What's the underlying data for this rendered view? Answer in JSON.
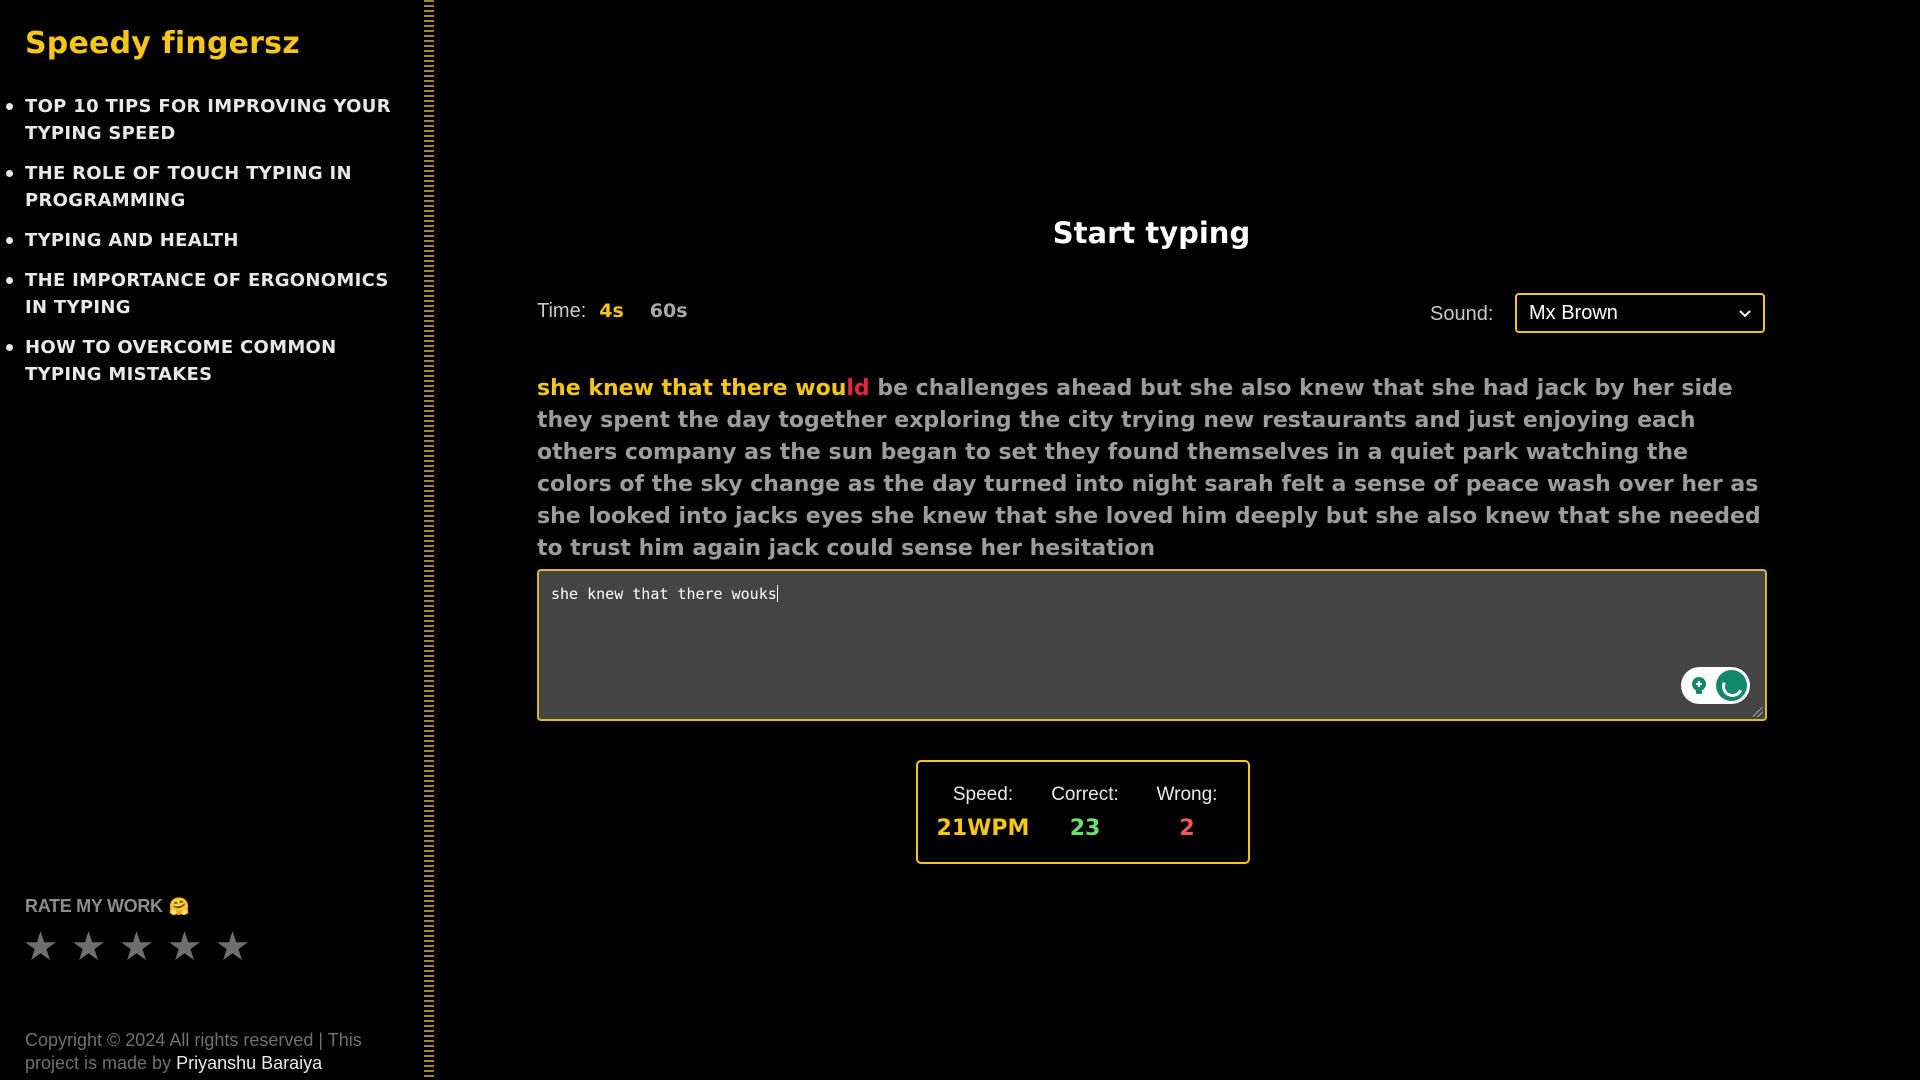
{
  "sidebar": {
    "brand": "Speedy fingersz",
    "items": [
      {
        "label": "TOP 10 TIPS FOR IMPROVING YOUR TYPING SPEED"
      },
      {
        "label": "THE ROLE OF TOUCH TYPING IN PROGRAMMING"
      },
      {
        "label": "TYPING AND HEALTH"
      },
      {
        "label": "THE IMPORTANCE OF ERGONOMICS IN TYPING"
      },
      {
        "label": "HOW TO OVERCOME COMMON TYPING MISTAKES"
      }
    ],
    "rate": {
      "title": "RATE MY WORK",
      "emoji": "🤗",
      "star_glyph": "★",
      "stars_max": 5,
      "rating": 0
    },
    "copyright": {
      "text": "Copyright © 2024 All rights reserved | This project is made by",
      "author": "Priyanshu Baraiya"
    }
  },
  "main": {
    "title": "Start typing",
    "time": {
      "label": "Time:",
      "options": [
        {
          "label": "4s",
          "active": true
        },
        {
          "label": "60s",
          "active": false
        }
      ]
    },
    "sound": {
      "label": "Sound:",
      "selected": "Mx Brown",
      "chevron": "⌄"
    },
    "passage": {
      "typed": "she knew that there wou",
      "wrong": "ld",
      "rest": " be challenges ahead but she also knew that she had jack by her side they spent the day together exploring the city trying new restaurants and just enjoying each others company as the sun began to set they found themselves in a quiet park watching the colors of the sky change as the day turned into night sarah felt a sense of peace wash over her as she looked into jacks eyes she knew that she loved him deeply but she also knew that she needed to trust him again jack could sense her hesitation"
    },
    "input": {
      "value": "she knew that there wouks"
    },
    "stats": {
      "speed": {
        "label": "Speed:",
        "value": "21WPM"
      },
      "correct": {
        "label": "Correct:",
        "value": "23"
      },
      "wrong": {
        "label": "Wrong:",
        "value": "2"
      }
    }
  },
  "colors": {
    "accent": "#f5c518",
    "background": "#000000",
    "correct": "#6ee06e",
    "wrong": "#ea5b5b",
    "error_char": "#e0283a"
  }
}
